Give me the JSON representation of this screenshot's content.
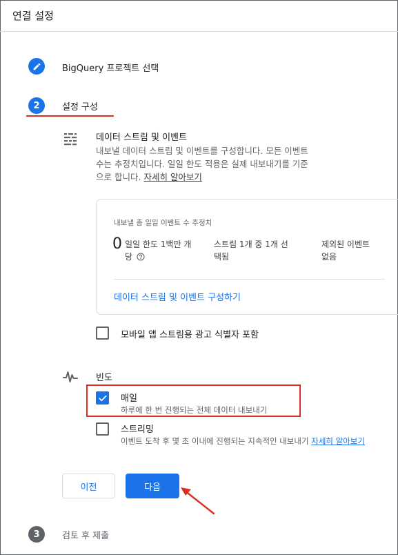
{
  "header": {
    "title": "연결 설정"
  },
  "steps": [
    {
      "number": "",
      "label": "BigQuery 프로젝트 선택"
    },
    {
      "number": "2",
      "label": "설정 구성"
    },
    {
      "number": "3",
      "label": "검토 후 제출"
    }
  ],
  "data_streams": {
    "title": "데이터 스트림 및 이벤트",
    "desc_line1": "내보낼 데이터 스트림 및 이벤트를 구성합니다. 모든 이벤트",
    "desc_line2": "수는 추정치입니다. 일일 한도 적용은 실제 내보내기를 기준",
    "desc_line3": "으로 합니다.",
    "learn_more": "자세히 알아보기"
  },
  "estimate_card": {
    "label": "내보낼 총 일일 이벤트 수 추정치",
    "value": "0",
    "stat1_line1": "일일 한도 1백만 개",
    "stat1_line2": "당",
    "stat2_line1": "스트림 1개 중 1개 선",
    "stat2_line2": "택됨",
    "stat3_line1": "제외된 이벤트",
    "stat3_line2": "없음",
    "link": "데이터 스트림 및 이벤트 구성하기"
  },
  "mobile_ads": {
    "label": "모바일 앱 스트림용 광고 식별자 포함",
    "checked": false
  },
  "frequency": {
    "title": "빈도",
    "daily": {
      "label": "매일",
      "desc": "하루에 한 번 진행되는 전체 데이터 내보내기",
      "checked": true
    },
    "streaming": {
      "label": "스트리밍",
      "desc": "이벤트 도착 후 몇 초 이내에 진행되는 지속적인 내보내기",
      "learn_more": "자세히 알아보기",
      "checked": false
    }
  },
  "buttons": {
    "prev": "이전",
    "next": "다음"
  },
  "colors": {
    "accent": "#1a73e8",
    "annotation": "#d93025",
    "grey": "#5f6368"
  },
  "icons": [
    "edit-pencil-icon",
    "data-streams-icon",
    "help-circle-icon",
    "frequency-pulse-icon",
    "checkmark-icon",
    "annotation-arrow-icon"
  ]
}
